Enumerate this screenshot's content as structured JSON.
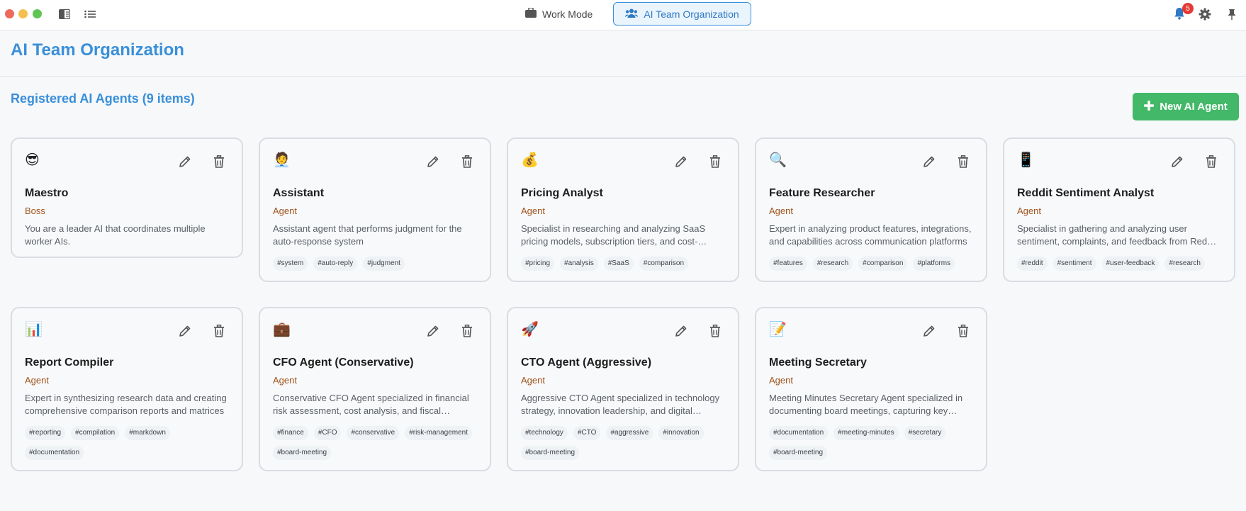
{
  "topbar": {
    "mode_tabs": [
      {
        "label": "Work Mode",
        "active": false
      },
      {
        "label": "AI Team Organization",
        "active": true
      }
    ],
    "notifications_count": "5"
  },
  "page": {
    "title": "AI Team Organization",
    "section_title": "Registered AI Agents (9 items)",
    "new_button_label": "New AI Agent"
  },
  "colors": {
    "accent": "#3a8fd9",
    "primary_button": "#43b868",
    "role_text": "#a0521a",
    "badge": "#e53935"
  },
  "agents": [
    {
      "emoji": "😎",
      "name": "Maestro",
      "role": "Boss",
      "description": "You are a leader AI that coordinates multiple worker AIs.",
      "tags": []
    },
    {
      "emoji": "🧑‍💼",
      "name": "Assistant",
      "role": "Agent",
      "description": "Assistant agent that performs judgment for the auto-response system",
      "tags": [
        "#system",
        "#auto-reply",
        "#judgment"
      ]
    },
    {
      "emoji": "💰",
      "name": "Pricing Analyst",
      "role": "Agent",
      "description": "Specialist in researching and analyzing SaaS pricing models, subscription tiers, and cost-benefit analysis",
      "tags": [
        "#pricing",
        "#analysis",
        "#SaaS",
        "#comparison"
      ]
    },
    {
      "emoji": "🔍",
      "name": "Feature Researcher",
      "role": "Agent",
      "description": "Expert in analyzing product features, integrations, and capabilities across communication platforms",
      "tags": [
        "#features",
        "#research",
        "#comparison",
        "#platforms"
      ]
    },
    {
      "emoji": "📱",
      "name": "Reddit Sentiment Analyst",
      "role": "Agent",
      "description": "Specialist in gathering and analyzing user sentiment, complaints, and feedback from Reddit communities",
      "tags": [
        "#reddit",
        "#sentiment",
        "#user-feedback",
        "#research"
      ]
    },
    {
      "emoji": "📊",
      "name": "Report Compiler",
      "role": "Agent",
      "description": "Expert in synthesizing research data and creating comprehensive comparison reports and matrices",
      "tags": [
        "#reporting",
        "#compilation",
        "#markdown",
        "#documentation"
      ]
    },
    {
      "emoji": "💼",
      "name": "CFO Agent (Conservative)",
      "role": "Agent",
      "description": "Conservative CFO Agent specialized in financial risk assessment, cost analysis, and fiscal responsibility",
      "tags": [
        "#finance",
        "#CFO",
        "#conservative",
        "#risk-management",
        "#board-meeting"
      ]
    },
    {
      "emoji": "🚀",
      "name": "CTO Agent (Aggressive)",
      "role": "Agent",
      "description": "Aggressive CTO Agent specialized in technology strategy, innovation leadership, and digital transformation",
      "tags": [
        "#technology",
        "#CTO",
        "#aggressive",
        "#innovation",
        "#board-meeting"
      ]
    },
    {
      "emoji": "📝",
      "name": "Meeting Secretary",
      "role": "Agent",
      "description": "Meeting Minutes Secretary Agent specialized in documenting board meetings, capturing key decisions",
      "tags": [
        "#documentation",
        "#meeting-minutes",
        "#secretary",
        "#board-meeting"
      ]
    }
  ]
}
